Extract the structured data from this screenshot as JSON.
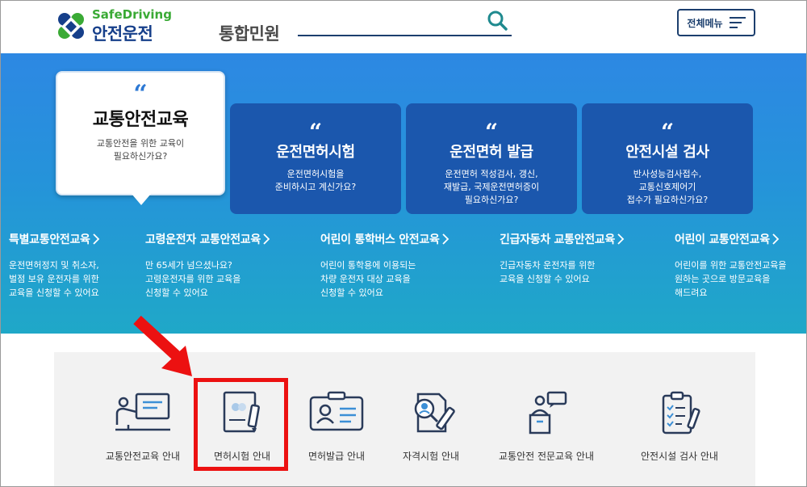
{
  "header": {
    "logo_en": "SafeDriving",
    "logo_ko": "안전운전",
    "logo_sub": "통합민원",
    "search_placeholder": "",
    "menu_label": "전체메뉴"
  },
  "colors": {
    "brand_blue": "#163f8a",
    "brand_green": "#3aaa35",
    "hero_top": "#2d88e3",
    "hero_bottom": "#1fa8c8",
    "card_bg": "#1b57ad",
    "highlight_red": "#ec1111"
  },
  "hero": {
    "bubble": {
      "quote": "“",
      "title": "교통안전교육",
      "desc_line1": "교통안전을 위한 교육이",
      "desc_line2": "필요하신가요?"
    },
    "cards": [
      {
        "quote": "“",
        "title": "운전면허시험",
        "desc": "운전면허시험을\n준비하시고 계신가요?"
      },
      {
        "quote": "“",
        "title": "운전면허 발급",
        "desc": "운전면허 적성검사, 갱신,\n재발급, 국제운전면허증이\n필요하신가요?"
      },
      {
        "quote": "“",
        "title": "안전시설 검사",
        "desc": "반사성능검사접수,\n교통신호제어기\n접수가 필요하신가요?"
      }
    ],
    "links": [
      {
        "title": "특별교통안전교육",
        "desc": "운전면허정지 및 취소자,\n벌점 보유 운전자를 위한\n교육을 신청할 수 있어요"
      },
      {
        "title": "고령운전자 교통안전교육",
        "desc": "만 65세가 넘으셨나요?\n고령운전자를 위한 교육을\n신청할 수 있어요"
      },
      {
        "title": "어린이 통학버스 안전교육",
        "desc": "어린이 통학용에 이용되는\n차량 운전자 대상 교육을\n신청할 수 있어요"
      },
      {
        "title": "긴급자동차 교통안전교육",
        "desc": "긴급자동차 운전자를 위한\n교육을 신청할 수 있어요"
      },
      {
        "title": "어린이 교통안전교육",
        "desc": "어린이를 위한 교통안전교육을\n원하는 곳으로 방문교육을\n해드려요"
      }
    ]
  },
  "services": [
    {
      "label": "교통안전교육 안내",
      "icon": "presentation-icon"
    },
    {
      "label": "면허시험 안내",
      "icon": "exam-document-icon"
    },
    {
      "label": "면허발급 안내",
      "icon": "license-card-icon"
    },
    {
      "label": "자격시험 안내",
      "icon": "qualification-test-icon"
    },
    {
      "label": "교통안전 전문교육 안내",
      "icon": "lecture-podium-icon"
    },
    {
      "label": "안전시설 검사 안내",
      "icon": "checklist-clipboard-icon"
    }
  ]
}
